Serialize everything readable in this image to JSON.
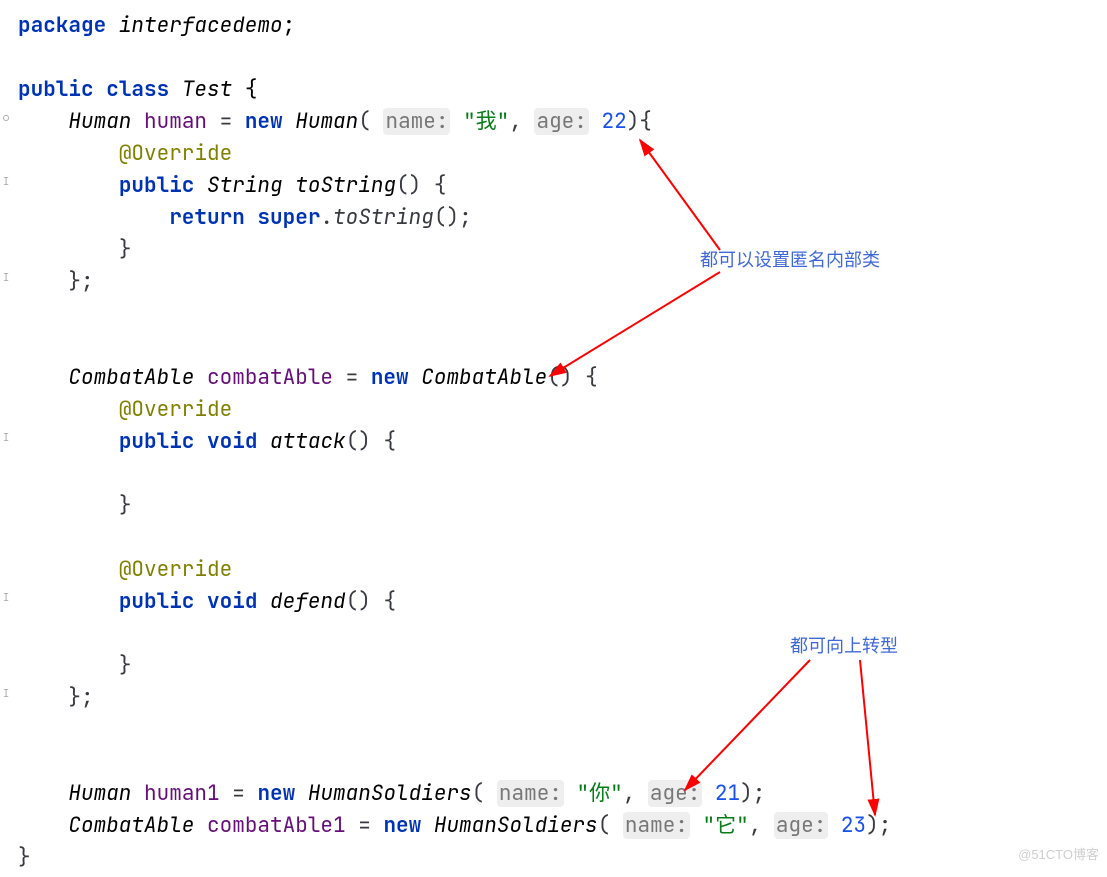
{
  "code": {
    "package_kw": "package",
    "package_name": "interfacedemo",
    "semicolon": ";",
    "public": "public",
    "class": "class",
    "class_name": "Test",
    "human_type": "Human",
    "human_var": "human",
    "equals": " = ",
    "new_kw": "new",
    "human_ctor": "Human",
    "hint_name": "name:",
    "hint_age": "age:",
    "str_me": "\"我\"",
    "num_22": "22",
    "override": "@Override",
    "string_type": "String",
    "toString": "toString",
    "return_kw": "return",
    "super_kw": "super",
    "combat_type": "CombatAble",
    "combat_var": "combatAble",
    "void": "void",
    "attack": "attack",
    "defend": "defend",
    "human1_var": "human1",
    "humansoldiers": "HumanSoldiers",
    "str_you": "\"你\"",
    "num_21": "21",
    "combat1_var": "combatAble1",
    "str_it": "\"它\"",
    "num_23": "23",
    "brace_open": " {",
    "brace_close": "}",
    "paren_open": "(",
    "paren_close": ")",
    "paren_close_brace": "){",
    "paren_close_sc": ");",
    "comma_sp": ", ",
    "dot": "."
  },
  "annotations": {
    "anon_class": "都可以设置匿名内部类",
    "upcast": "都可向上转型"
  },
  "watermark": "@51CTO博客",
  "colors": {
    "keyword": "#0033B3",
    "annotation": "#808000",
    "string": "#067D17",
    "number": "#1750EB",
    "hint_bg": "#eeeeee",
    "comment_blue": "#3e68d7",
    "arrow_red": "#ff0000"
  }
}
